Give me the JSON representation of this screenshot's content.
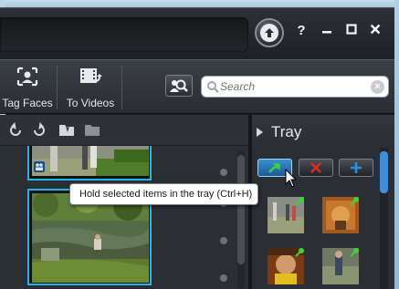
{
  "window": {
    "controls": {
      "help": "?",
      "minimize": "−",
      "maximize": "□",
      "close": "✕"
    },
    "upload_icon": "arrow-up-icon"
  },
  "toolbar": {
    "tag_faces_label": "Tag Faces",
    "to_videos_label": "To Videos"
  },
  "search": {
    "placeholder": "Search"
  },
  "tray": {
    "title": "Tray",
    "buttons": [
      "hold-icon",
      "remove-icon",
      "add-icon"
    ]
  },
  "tooltip": {
    "text": "Hold selected items in the tray  (Ctrl+H)"
  },
  "colors": {
    "accent": "#22b4ea",
    "tray_active": "#2f7fc4",
    "remove": "#e02a2a",
    "add": "#2a8fe0",
    "pin": "#3ed13e"
  }
}
